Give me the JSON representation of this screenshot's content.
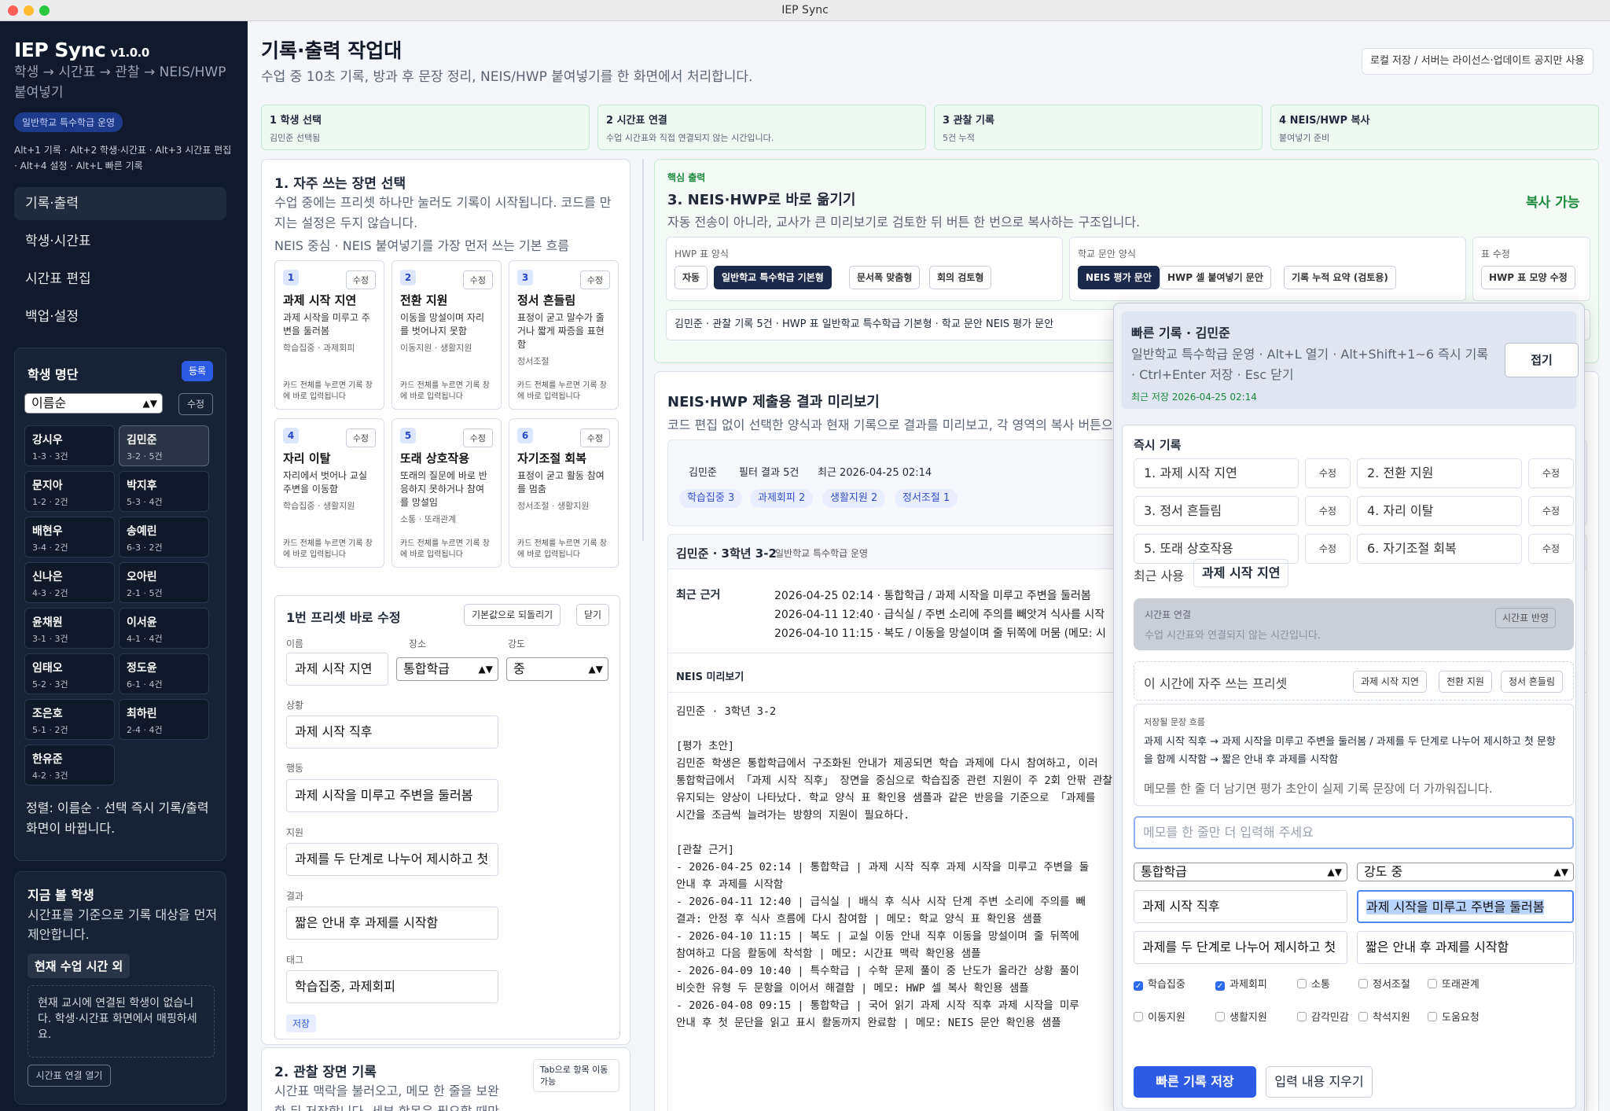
{
  "window": {
    "title": "IEP Sync"
  },
  "sidebar": {
    "app_name": "IEP Sync",
    "version": "v1.0.0",
    "subtitle": "학생 → 시간표 → 관찰 → NEIS/HWP 붙여넣기",
    "mode_chip": "일반학교 특수학급 운영",
    "shortcuts": "Alt+1 기록 · Alt+2 학생·시간표 · Alt+3 시간표 편집 · Alt+4 설정 · Alt+L 빠른 기록",
    "nav": [
      {
        "label": "기록·출력"
      },
      {
        "label": "학생·시간표"
      },
      {
        "label": "시간표 편집"
      },
      {
        "label": "백업·설정"
      }
    ],
    "roster": {
      "title": "학생 명단",
      "register": "등록",
      "sort": "이름순",
      "edit": "수정",
      "students": [
        {
          "name": "강시우",
          "meta": "1-3 · 3건"
        },
        {
          "name": "김민준",
          "meta": "3-2 · 5건"
        },
        {
          "name": "문지아",
          "meta": "1-2 · 2건"
        },
        {
          "name": "박지후",
          "meta": "5-3 · 4건"
        },
        {
          "name": "배현우",
          "meta": "3-4 · 2건"
        },
        {
          "name": "송예린",
          "meta": "6-3 · 2건"
        },
        {
          "name": "신나은",
          "meta": "4-3 · 2건"
        },
        {
          "name": "오아린",
          "meta": "2-1 · 5건"
        },
        {
          "name": "윤채원",
          "meta": "3-1 · 3건"
        },
        {
          "name": "이서윤",
          "meta": "4-1 · 4건"
        },
        {
          "name": "임태오",
          "meta": "5-2 · 3건"
        },
        {
          "name": "정도윤",
          "meta": "6-1 · 4건"
        },
        {
          "name": "조은호",
          "meta": "5-1 · 2건"
        },
        {
          "name": "최하린",
          "meta": "2-4 · 4건"
        },
        {
          "name": "한유준",
          "meta": "4-2 · 3건"
        }
      ],
      "note": "정렬: 이름순 · 선택 즉시 기록/출력 화면이 바뀝니다."
    },
    "now": {
      "title": "지금 볼 학생",
      "desc": "시간표를 기준으로 기록 대상을 먼저 제안합니다.",
      "badge": "현재 수업 시간 외",
      "empty": "현재 교시에 연결된 학생이 없습니다. 학생·시간표 화면에서 매핑하세요.",
      "button": "시간표 연결 열기"
    }
  },
  "header": {
    "title": "기록·출력 작업대",
    "desc": "수업 중 10초 기록, 방과 후 문장 정리, NEIS/HWP 붙여넣기를 한 화면에서 처리합니다.",
    "notice": "로컬 저장 / 서버는 라이선스·업데이트 공지만 사용"
  },
  "steps": [
    {
      "title": "1 학생 선택",
      "sub": "김민준 선택됨"
    },
    {
      "title": "2 시간표 연결",
      "sub": "수업 시간표와 직접 연결되지 않는 시간입니다."
    },
    {
      "title": "3 관찰 기록",
      "sub": "5건 누적"
    },
    {
      "title": "4 NEIS/HWP 복사",
      "sub": "붙여넣기 준비"
    }
  ],
  "scenes": {
    "title": "1. 자주 쓰는 장면 선택",
    "desc": "수업 중에는 프리셋 하나만 눌러도 기록이 시작됩니다. 코드를 만지는 설정은 두지 않습니다.",
    "flow": "NEIS 중심 · NEIS 붙여넣기를 가장 먼저 쓰는 기본 흐름",
    "edit_label": "수정",
    "hint": "카드 전체를 누르면 기록 창에 바로 입력됩니다",
    "presets": [
      {
        "num": "1",
        "title": "과제 시작 지연",
        "desc": "과제 시작을 미루고 주변을 둘러봄",
        "tags": "학습집중 · 과제회피"
      },
      {
        "num": "2",
        "title": "전환 지원",
        "desc": "이동을 망설이며 자리를 벗어나지 못함",
        "tags": "이동지원 · 생활지원"
      },
      {
        "num": "3",
        "title": "정서 흔들림",
        "desc": "표정이 굳고 말수가 줄거나 짧게 짜증을 표현함",
        "tags": "정서조절"
      },
      {
        "num": "4",
        "title": "자리 이탈",
        "desc": "자리에서 벗어나 교실 주변을 이동함",
        "tags": "학습집중 · 생활지원"
      },
      {
        "num": "5",
        "title": "또래 상호작용",
        "desc": "또래의 질문에 바로 반응하지 못하거나 참여를 망설임",
        "tags": "소통 · 또래관계"
      },
      {
        "num": "6",
        "title": "자기조절 회복",
        "desc": "표정이 굳고 활동 참여를 멈춤",
        "tags": "정서조절 · 생활지원"
      }
    ]
  },
  "preset_edit": {
    "title": "1번 프리셋 바로 수정",
    "reset": "기본값으로 되돌리기",
    "close": "닫기",
    "labels": {
      "name": "이름",
      "place": "장소",
      "level": "강도",
      "situation": "상황",
      "action": "행동",
      "support": "지원",
      "result": "결과",
      "tags": "태그"
    },
    "name": "과제 시작 지연",
    "place": "통합학급",
    "level": "중",
    "situation": "과제 시작 직후",
    "action": "과제 시작을 미루고 주변을 둘러봄",
    "support": "과제를 두 단계로 나누어 제시하고 첫",
    "result": "짧은 안내 후 과제를 시작함",
    "tags": "학습집중, 과제회피",
    "save": "저장"
  },
  "observe": {
    "title": "2. 관찰 장면 기록",
    "desc": "시간표 맥락을 불러오고, 메모 한 줄을 보완한 뒤 저장합니다. 세부 항목은 필요할 때만",
    "tab_hint": "Tab으로 항목 이동 가능"
  },
  "neis": {
    "kicker": "핵심 출력",
    "title": "3. NEIS·HWP로 바로 옮기기",
    "desc": "자동 전송이 아니라, 교사가 큰 미리보기로 검토한 뒤 버튼 한 번으로 복사하는 구조입니다.",
    "status": "복사 가능",
    "hwp_group": "HWP 표 양식",
    "hwp_opts": [
      "자동",
      "일반학교 특수학급 기본형",
      "문서폭 맞춤형",
      "회의 검토형"
    ],
    "school_group": "학교 문안 양식",
    "school_opts": [
      "NEIS 평가 문안",
      "HWP 셀 붙여넣기 문안",
      "기록 누적 요약 (검토용)"
    ],
    "table_group": "표 수정",
    "table_btn": "HWP 표 모양 수정",
    "summary": "김민준 · 관찰 기록 5건 · HWP 표 일반학교 특수학급 기본형 · 학교 문안 NEIS 평가 문안"
  },
  "preview": {
    "title": "NEIS·HWP 제출용 결과 미리보기",
    "desc": "코드 편집 없이 선택한 양식과 현재 기록으로 결과를 미리보고, 각 영역의 복사 버튼으로",
    "meta": {
      "name": "김민준",
      "filter": "필터 결과 5건",
      "recent": "최근 2026-04-25 02:14"
    },
    "chips": [
      "학습집중 3",
      "과제회피 2",
      "생활지원 2",
      "정서조절 1"
    ],
    "student_head": "김민준 · 3학년 3-2",
    "student_sub": "일반학교 특수학급 운영",
    "evidence_label": "최근 근거",
    "evidence": [
      "2026-04-25 02:14 · 통합학급 / 과제 시작을 미루고 주변을 둘러봄",
      "2026-04-11 12:40 · 급식실 / 주변 소리에 주의를 빼앗겨 식사를 시작",
      "2026-04-10 11:15 · 복도 / 이동을 망설이며 줄 뒤쪽에 머뭄 (메모: 시"
    ],
    "neis_label": "NEIS 미리보기",
    "neis_lines": [
      "김민준 · 3학년 3-2",
      "",
      "[평가 초안]",
      "김민준 학생은 통합학급에서 구조화된 안내가 제공되면 학습 과제에 다시 참여하고, 이러",
      "통합학급에서 「과제 시작 직후」 장면을 중심으로 학습집중 관련 지원이 주 2회 안팎 관찰",
      "유지되는 양상이 나타났다. 학교 양식 표 확인용 샘플과 같은 반응을 기준으로 「과제를",
      "시간을 조금씩 늘려가는 방향의 지원이 필요하다.",
      "",
      "[관찰 근거]",
      "- 2026-04-25 02:14 | 통합학급 | 과제 시작 직후 과제 시작을 미루고 주변을 둘",
      "안내 후 과제를 시작함",
      "- 2026-04-11 12:40 | 급식실 | 배식 후 식사 시작 단계 주변 소리에 주의를 빼",
      "결과: 안정 후 식사 흐름에 다시 참여함 | 메모: 학교 양식 표 확인용 샘플",
      "- 2026-04-10 11:15 | 복도 | 교실 이동 안내 직후 이동을 망설이며 줄 뒤쪽에",
      "참여하고 다음 활동에 착석함 | 메모: 시간표 맥락 확인용 샘플",
      "- 2026-04-09 10:40 | 특수학급 | 수학 문제 풀이 중 난도가 올라간 상황 풀이",
      "비슷한 유형 두 문항을 이어서 해결함 | 메모: HWP 셀 복사 확인용 샘플",
      "- 2026-04-08 09:15 | 통합학급 | 국어 읽기 과제 시작 직후 과제 시작을 미루",
      "안내 후 첫 문단을 읽고 표시 활동까지 완료함 | 메모: NEIS 문안 확인용 샘플"
    ]
  },
  "quick": {
    "title": "빠른 기록 · 김민준",
    "desc": "일반학교 특수학급 운영 · Alt+L 열기 · Alt+Shift+1~6 즉시 기록 · Ctrl+Enter 저장 · Esc 닫기",
    "saved": "최근 저장 2026-04-25 02:14",
    "collapse": "접기",
    "instant_title": "즉시 기록",
    "edit_label": "수정",
    "presets": [
      "1. 과제 시작 지연",
      "2. 전환 지원",
      "3. 정서 흔들림",
      "4. 자리 이탈",
      "5. 또래 상호작용",
      "6. 자기조절 회복"
    ],
    "recent_label": "최근 사용",
    "recent_value": "과제 시작 지연",
    "timetable": {
      "label": "시간표 연결",
      "text": "수업 시간표와 연결되지 않는 시간입니다.",
      "button": "시간표 반영"
    },
    "freq_label": "이 시간에 자주 쓰는 프리셋",
    "freq": [
      "과제 시작 지연",
      "전환 지원",
      "정서 흔들림"
    ],
    "flow_label": "저장될 문장 흐름",
    "flow_text": "과제 시작 직후 → 과제 시작을 미루고 주변을 둘러봄 / 과제를 두 단계로 나누어 제시하고 첫 문항을 함께 시작함 → 짧은 안내 후 과제를 시작함",
    "flow_hint": "메모를 한 줄 더 남기면 평가 초안이 실제 기록 문장에 더 가까워집니다.",
    "memo_placeholder": "메모를 한 줄만 더 입력해 주세요",
    "place": "통합학급",
    "level": "강도 중",
    "situation": "과제 시작 직후",
    "action": "과제 시작을 미루고 주변을 둘러봄",
    "support": "과제를 두 단계로 나누어 제시하고 첫",
    "result": "짧은 안내 후 과제를 시작함",
    "tags": [
      {
        "label": "학습집중",
        "checked": true
      },
      {
        "label": "과제회피",
        "checked": true
      },
      {
        "label": "소통",
        "checked": false
      },
      {
        "label": "정서조절",
        "checked": false
      },
      {
        "label": "또래관계",
        "checked": false
      },
      {
        "label": "이동지원",
        "checked": false
      },
      {
        "label": "생활지원",
        "checked": false
      },
      {
        "label": "감각민감",
        "checked": false
      },
      {
        "label": "착석지원",
        "checked": false
      },
      {
        "label": "도움요청",
        "checked": false
      }
    ],
    "save": "빠른 기록 저장",
    "clear": "입력 내용 지우기"
  },
  "colors": {
    "sidebar": "#101a2c",
    "accent": "#2d5be3",
    "success": "#1a8a3a",
    "step_bg": "#eefaf1"
  }
}
